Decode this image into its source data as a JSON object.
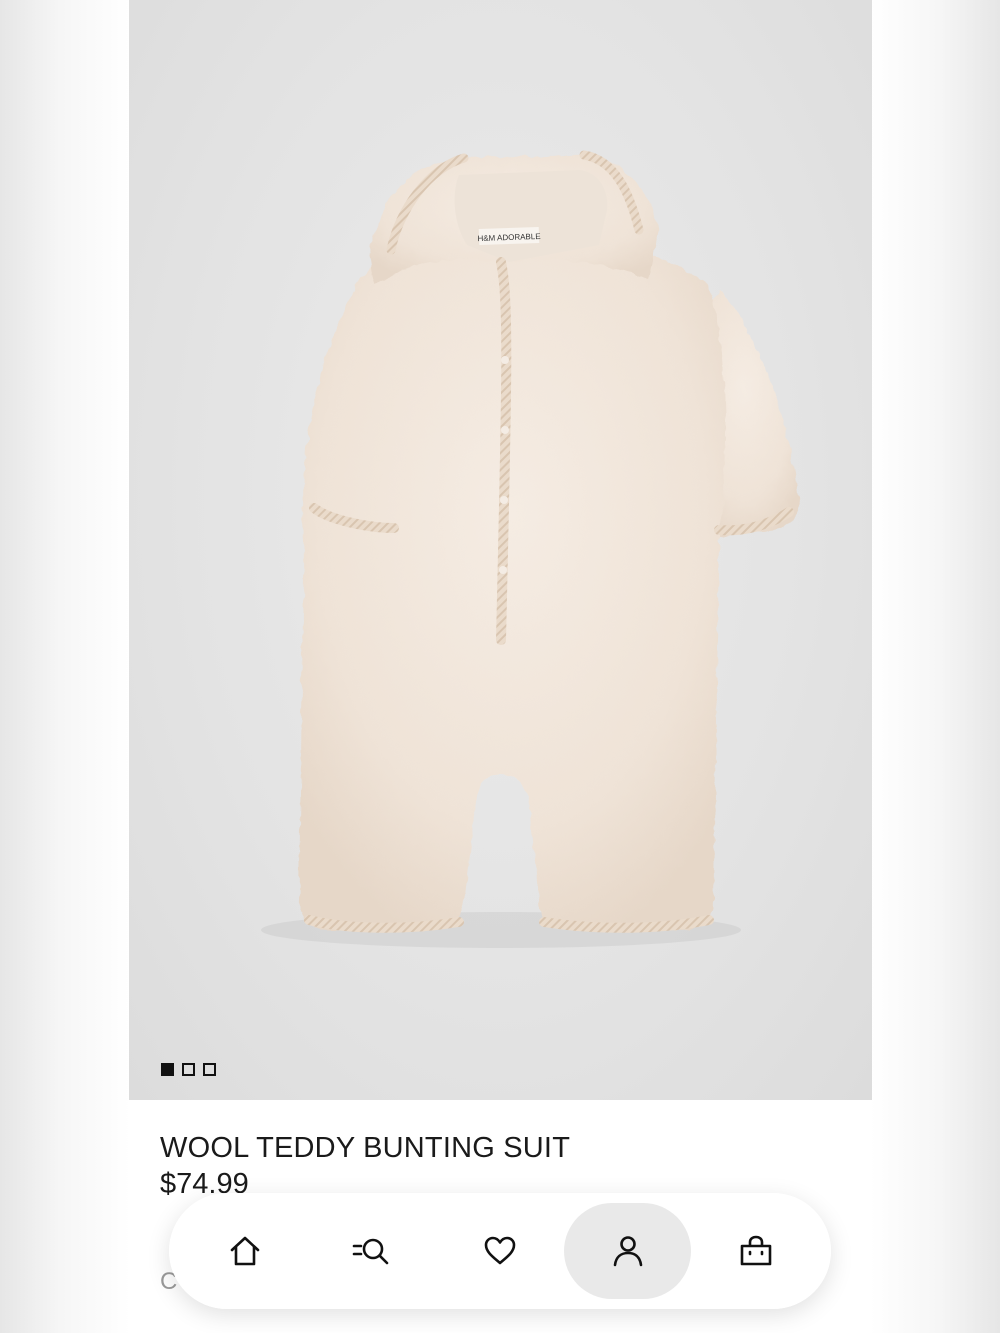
{
  "product": {
    "title": "WOOL TEDDY BUNTING SUIT",
    "price": "$74.99",
    "color_label_partial": "C  ",
    "image_alt": "Cream wool teddy bunting suit with hood",
    "label_text": "ADORABLE"
  },
  "gallery": {
    "total": 3,
    "active_index": 0
  },
  "nav": {
    "items": [
      {
        "name": "home",
        "icon": "home-icon"
      },
      {
        "name": "search",
        "icon": "search-icon"
      },
      {
        "name": "favorites",
        "icon": "heart-icon"
      },
      {
        "name": "account",
        "icon": "user-icon",
        "active": true
      },
      {
        "name": "bag",
        "icon": "shopping-bag-icon"
      }
    ]
  },
  "colors": {
    "fabric": "#f1e6dc",
    "trim": "#e8d9c8",
    "hero_bg": "#e4e4e4",
    "text": "#1a1a1a"
  }
}
